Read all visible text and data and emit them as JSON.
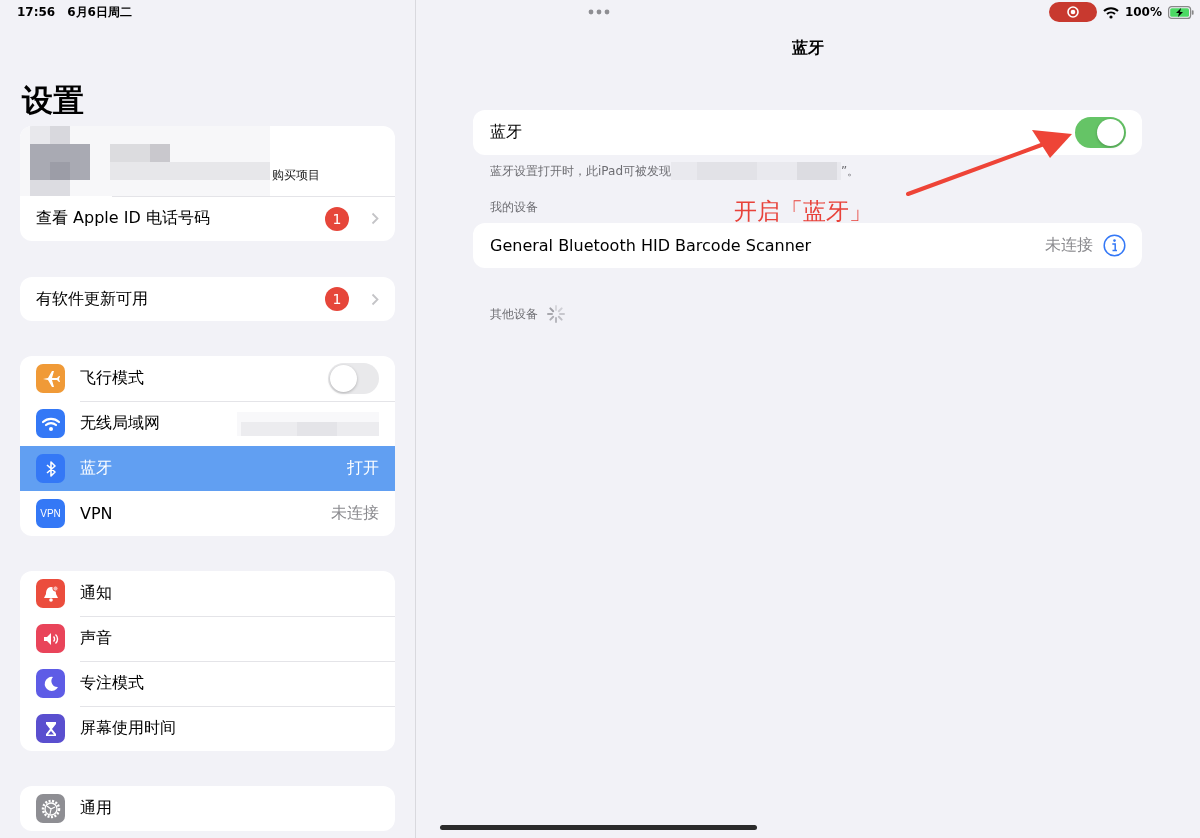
{
  "status_bar": {
    "time": "17:56",
    "date": "6月6日周二",
    "recording": true,
    "battery": "100%",
    "charging": true
  },
  "sidebar": {
    "title": "设置",
    "account": {
      "subtitle": "购买项目"
    },
    "apple_id_row": {
      "label": "查看 Apple ID 电话号码",
      "badge": "1"
    },
    "update_row": {
      "label": "有软件更新可用",
      "badge": "1"
    },
    "groups": [
      [
        {
          "label": "飞行模式",
          "kind": "toggle",
          "on": false,
          "selected": false,
          "color": "#f09a37"
        },
        {
          "label": "无线局域网",
          "kind": "hidden_value",
          "selected": false,
          "color": "#3478f6"
        },
        {
          "label": "蓝牙",
          "kind": "value",
          "value": "打开",
          "selected": true,
          "color": "#3478f6"
        },
        {
          "label": "VPN",
          "kind": "value",
          "value": "未连接",
          "icon_text": "VPN",
          "selected": false,
          "color": "#3478f6"
        }
      ],
      [
        {
          "label": "通知",
          "kind": "link",
          "selected": false,
          "color": "#eb4d3d"
        },
        {
          "label": "声音",
          "kind": "link",
          "selected": false,
          "color": "#e9445a"
        },
        {
          "label": "专注模式",
          "kind": "link",
          "selected": false,
          "color": "#5e5ce6"
        },
        {
          "label": "屏幕使用时间",
          "kind": "link",
          "selected": false,
          "color": "#5a4fcf"
        }
      ],
      [
        {
          "label": "通用",
          "kind": "link",
          "selected": false,
          "color": "#8e8e93"
        }
      ]
    ]
  },
  "detail": {
    "title": "蓝牙",
    "toggle": {
      "label": "蓝牙",
      "on": true
    },
    "footer_text": "蓝牙设置打开时，此iPad可被发现",
    "footer_tail": "”。",
    "my_devices_header": "我的设备",
    "devices": [
      {
        "name": "General Bluetooth HID Barcode Scanner",
        "status": "未连接"
      }
    ],
    "other_devices_header": "其他设备",
    "searching": true
  },
  "annotation": {
    "text": "开启「蓝牙」"
  }
}
